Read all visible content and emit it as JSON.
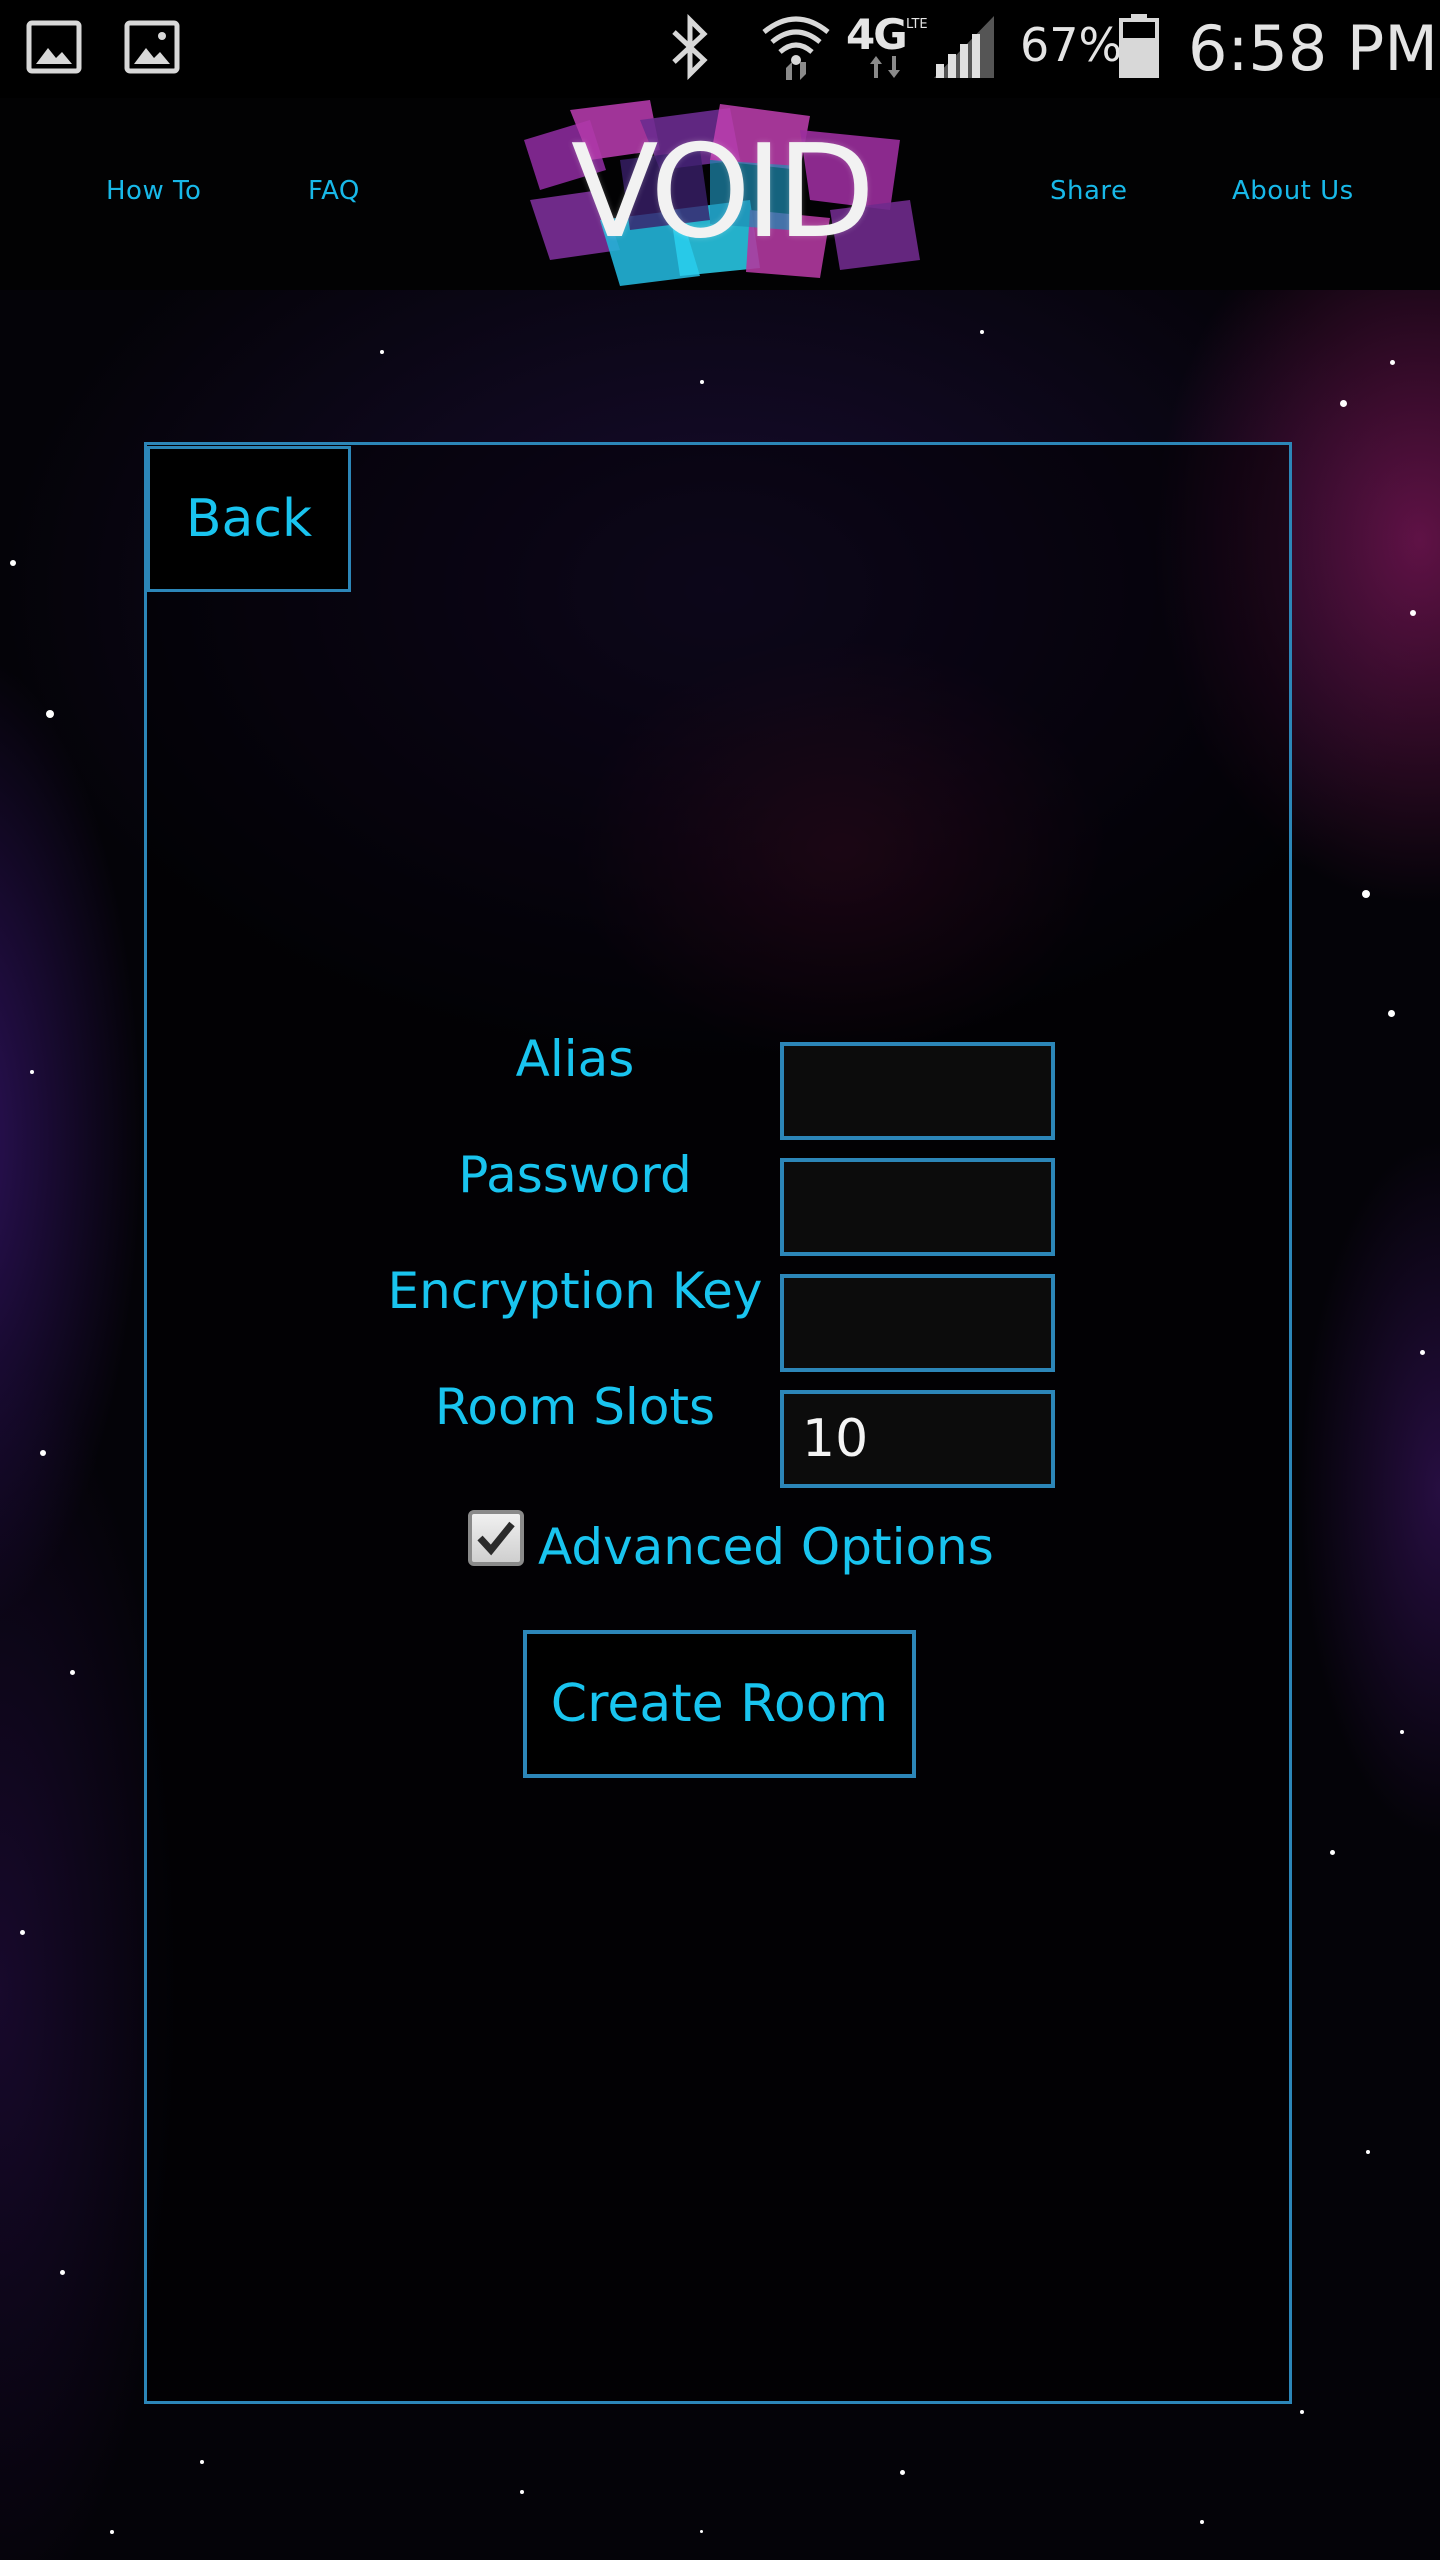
{
  "status_bar": {
    "battery": "67%",
    "time": "6:58 PM",
    "network": "4G",
    "network_sub": "LTE",
    "icons": [
      "gallery-icon",
      "gallery-icon",
      "bluetooth-icon",
      "wifi-icon",
      "lte-icon",
      "signal-icon",
      "battery-icon"
    ]
  },
  "header": {
    "logo": "VOID",
    "nav_left": [
      "How To",
      "FAQ"
    ],
    "nav_right": [
      "Share",
      "About Us"
    ]
  },
  "form": {
    "back_label": "Back",
    "alias_label": "Alias",
    "password_label": "Password",
    "encryption_label": "Encryption Key",
    "room_slots_label": "Room Slots",
    "alias_value": "",
    "password_value": "",
    "encryption_value": "",
    "room_slots_value": "10",
    "advanced_options_label": "Advanced Options",
    "advanced_options_checked": true,
    "create_label": "Create Room"
  },
  "colors": {
    "accent": "#19c4ef",
    "border": "#2c86b8",
    "background": "#000000"
  }
}
